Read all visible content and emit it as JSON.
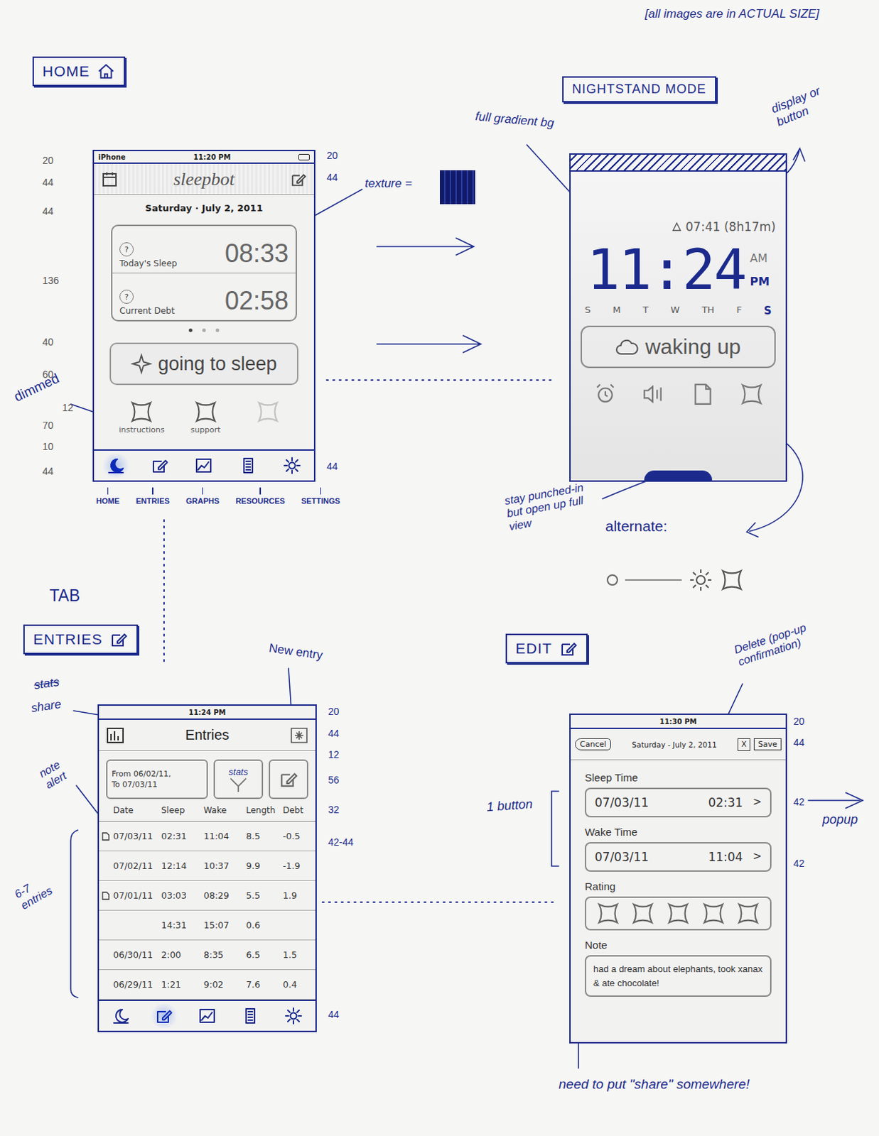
{
  "page_note": "[all images are in ACTUAL SIZE]",
  "home": {
    "heading": "HOME",
    "status": {
      "carrier": "iPhone",
      "time": "11:20 PM"
    },
    "title": "sleepbot",
    "date": "Saturday · July 2, 2011",
    "stats": [
      {
        "help": "?",
        "label": "Today's Sleep",
        "value": "08:33"
      },
      {
        "help": "?",
        "label": "Current Debt",
        "value": "02:58"
      }
    ],
    "pages": [
      {
        "selected": true
      },
      {
        "selected": false
      },
      {
        "selected": false
      }
    ],
    "action": "going to sleep",
    "shortcuts": [
      {
        "label": "instructions",
        "dimmed": false
      },
      {
        "label": "support",
        "dimmed": false
      },
      {
        "label": "",
        "dimmed": true
      }
    ],
    "tabs": [
      {
        "label": "HOME",
        "selected": true
      },
      {
        "label": "ENTRIES",
        "selected": false
      },
      {
        "label": "GRAPHS",
        "selected": false
      },
      {
        "label": "RESOURCES",
        "selected": false
      },
      {
        "label": "SETTINGS",
        "selected": false
      }
    ],
    "measures_left": [
      "20",
      "44",
      "44",
      "136",
      "40",
      "60",
      "12",
      "70",
      "10",
      "44"
    ],
    "measures_right": [
      "20",
      "44",
      "44"
    ],
    "annotations": {
      "dimmed": "dimmed",
      "texture": "texture ="
    }
  },
  "nightstand": {
    "heading": "NIGHTSTAND MODE",
    "alarm": "07:41 (8h17m)",
    "clock": "11:24",
    "meridiem": [
      {
        "label": "AM",
        "selected": false
      },
      {
        "label": "PM",
        "selected": true
      }
    ],
    "days": [
      {
        "label": "S",
        "selected": false
      },
      {
        "label": "M",
        "selected": false
      },
      {
        "label": "T",
        "selected": false
      },
      {
        "label": "W",
        "selected": false
      },
      {
        "label": "TH",
        "selected": false
      },
      {
        "label": "F",
        "selected": false
      },
      {
        "label": "S",
        "selected": true
      }
    ],
    "action": "waking up",
    "annotations": {
      "gradient": "full gradient bg",
      "display": "display or button",
      "punched": "stay punched-in but open up full view",
      "alternate": "alternate:"
    }
  },
  "entries": {
    "tab_label": "TAB",
    "heading": "ENTRIES",
    "status_time": "11:24 PM",
    "title": "Entries",
    "range": {
      "from": "From 06/02/11,",
      "to": "To 07/03/11"
    },
    "stats_button": "stats",
    "columns": [
      "Date",
      "Sleep",
      "Wake",
      "Length",
      "Debt"
    ],
    "rows": [
      {
        "note": true,
        "date": "07/03/11",
        "sleep": "02:31",
        "wake": "11:04",
        "length": "8.5",
        "debt": "-0.5"
      },
      {
        "note": false,
        "date": "07/02/11",
        "sleep": "12:14",
        "wake": "10:37",
        "length": "9.9",
        "debt": "-1.9"
      },
      {
        "note": true,
        "date": "07/01/11",
        "sleep": "03:03",
        "wake": "08:29",
        "length": "5.5",
        "debt": "1.9"
      },
      {
        "note": false,
        "date": "",
        "sleep": "14:31",
        "wake": "15:07",
        "length": "0.6",
        "debt": ""
      },
      {
        "note": false,
        "date": "06/30/11",
        "sleep": "2:00",
        "wake": "8:35",
        "length": "6.5",
        "debt": "1.5"
      },
      {
        "note": false,
        "date": "06/29/11",
        "sleep": "1:21",
        "wake": "9:02",
        "length": "7.6",
        "debt": "0.4"
      }
    ],
    "tabs": [
      {
        "selected": false
      },
      {
        "selected": true
      },
      {
        "selected": false
      },
      {
        "selected": false
      },
      {
        "selected": false
      }
    ],
    "measures_right": [
      "20",
      "44",
      "12",
      "56",
      "32",
      "42-44",
      "44"
    ],
    "annotations": {
      "new_entry": "New entry",
      "stats_struck": "stats",
      "share": "share",
      "note_alert": "note alert",
      "count": "6-7 entries"
    }
  },
  "edit": {
    "heading": "EDIT",
    "status_time": "11:30 PM",
    "cancel": "Cancel",
    "title": "Saturday - July 2, 2011",
    "delete": "X",
    "save": "Save",
    "fields": [
      {
        "label": "Sleep Time",
        "date": "07/03/11",
        "time": "02:31",
        "chevron": ">"
      },
      {
        "label": "Wake Time",
        "date": "07/03/11",
        "time": "11:04",
        "chevron": ">"
      }
    ],
    "rating": {
      "label": "Rating",
      "stars": 0
    },
    "note_label": "Note",
    "note": "had a dream about elephants, took xanax & ate chocolate!",
    "measures_right": [
      "20",
      "44",
      "42",
      "42"
    ],
    "annotations": {
      "delete": "Delete (pop-up confirmation)",
      "button": "1 button",
      "popup": "popup",
      "share": "need to put \"share\" somewhere!"
    }
  }
}
